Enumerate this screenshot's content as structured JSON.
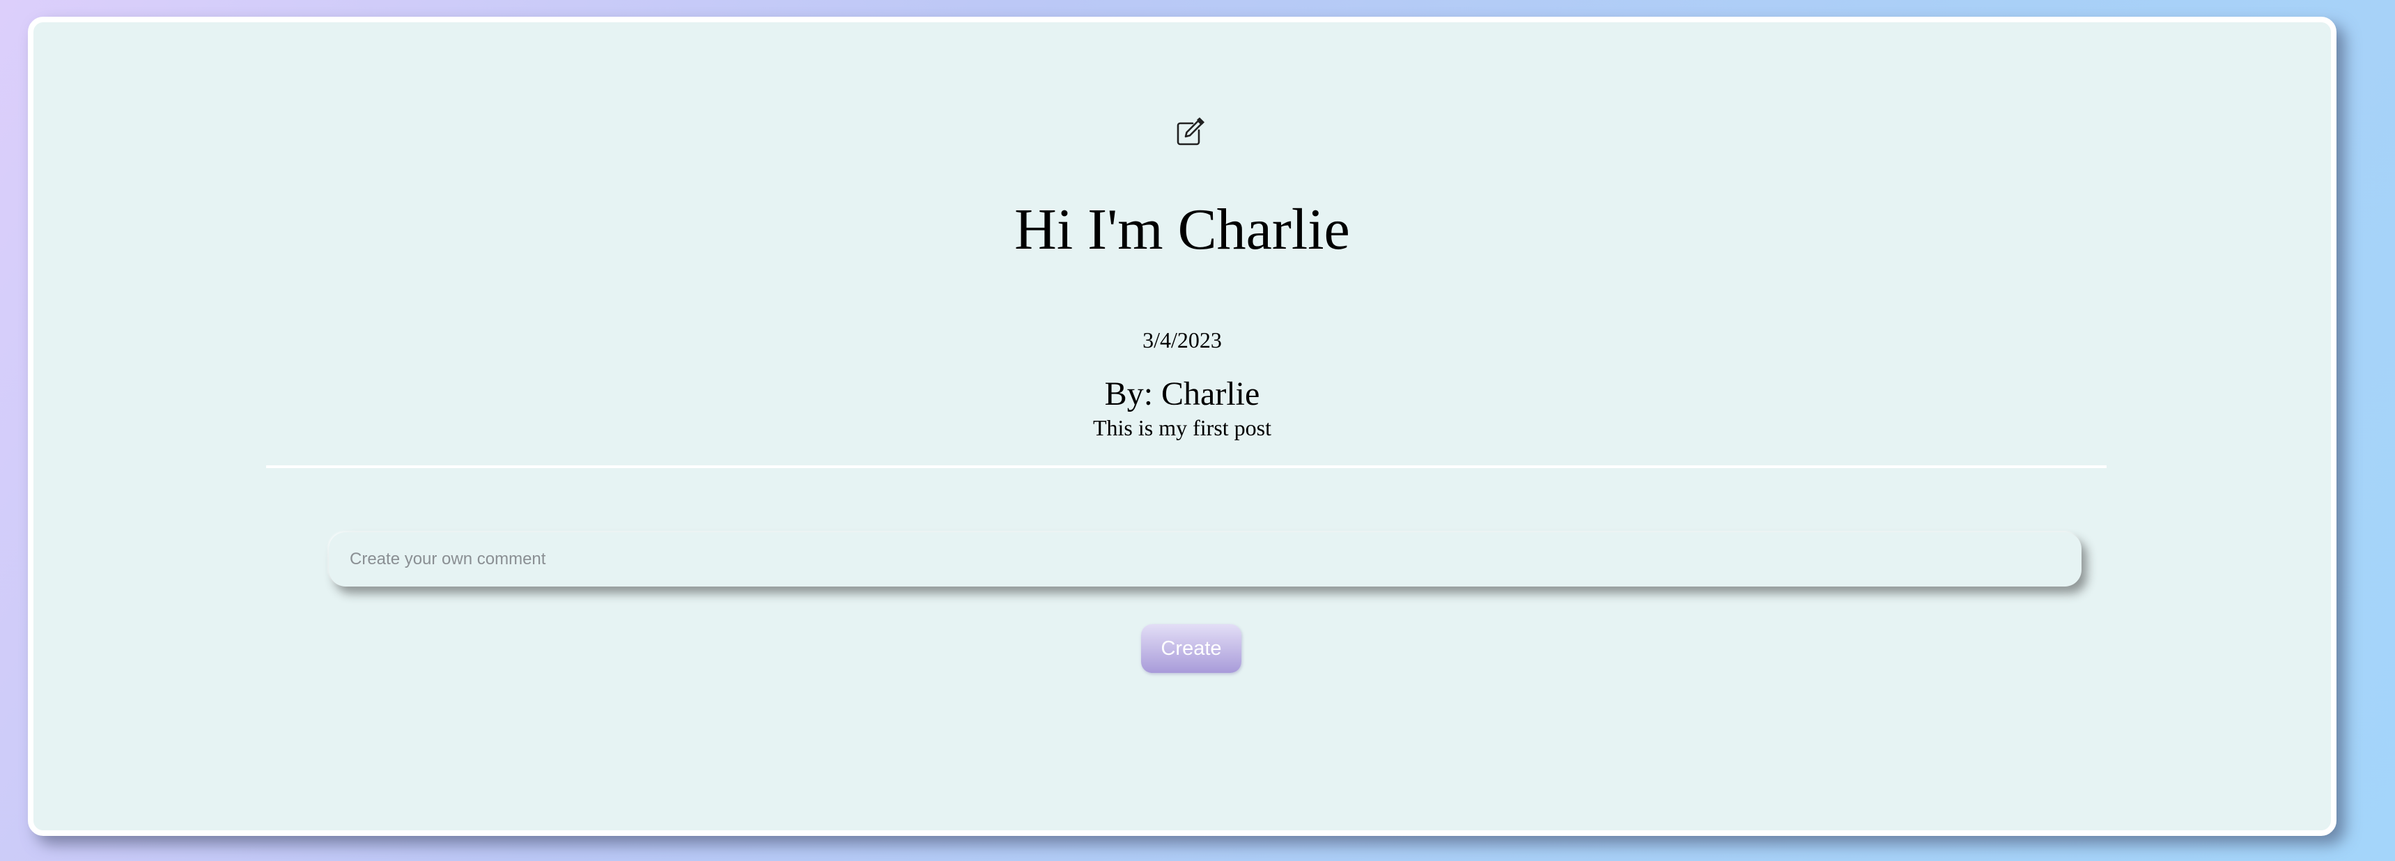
{
  "post": {
    "edit_icon": "edit-icon",
    "title": "Hi I'm Charlie",
    "date": "3/4/2023",
    "author": "By: Charlie",
    "body": "This is my first post"
  },
  "comment_form": {
    "placeholder": "Create your own comment",
    "value": "",
    "create_label": "Create"
  },
  "colors": {
    "card_background": "#e6f3f3",
    "card_border": "#ffffff",
    "button_gradient_top": "#e3def6",
    "button_gradient_bottom": "#a89bd9",
    "page_gradient_start": "#dccffb",
    "page_gradient_end": "#a4d5fa"
  }
}
